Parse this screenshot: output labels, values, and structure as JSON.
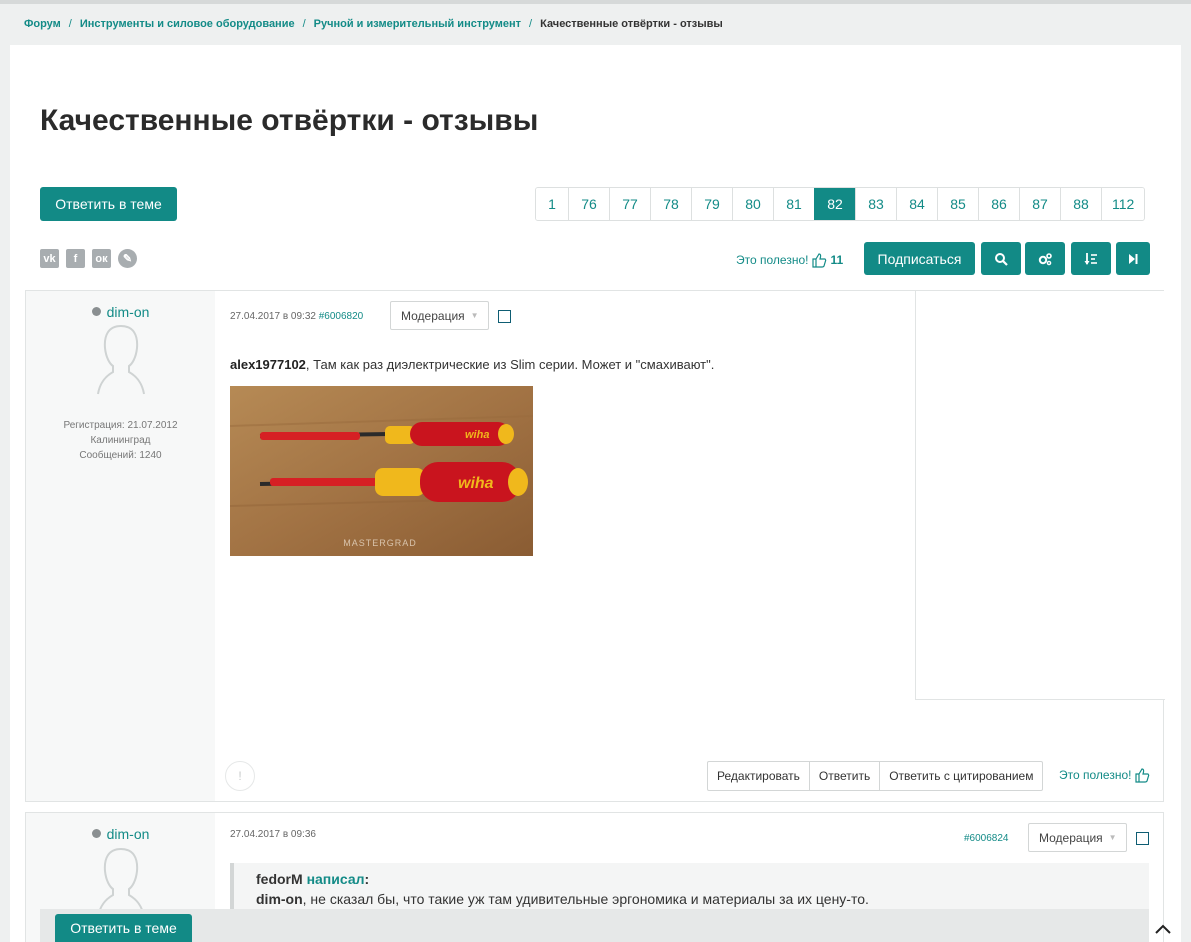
{
  "breadcrumb": {
    "items": [
      "Форум",
      "Инструменты и силовое оборудование",
      "Ручной и измерительный инструмент"
    ],
    "current": "Качественные отвёртки - отзывы"
  },
  "page_title": "Качественные отвёртки - отзывы",
  "reply_button": "Ответить в теме",
  "pagination": {
    "pages": [
      "1",
      "76",
      "77",
      "78",
      "79",
      "80",
      "81",
      "82",
      "83",
      "84",
      "85",
      "86",
      "87",
      "88",
      "112"
    ],
    "active": "82"
  },
  "social": [
    "vk",
    "f",
    "ok",
    "lj"
  ],
  "useful_top": {
    "label": "Это полезно!",
    "count": "11"
  },
  "subscribe_button": "Подписаться",
  "tools": [
    "search-icon",
    "settings-icon",
    "sort-icon",
    "last-page-icon"
  ],
  "colors": {
    "accent": "#128a86",
    "link": "#138b87",
    "background": "#eef0f0"
  },
  "posts": [
    {
      "author": "dim-on",
      "registration": "Регистрация: 21.07.2012",
      "city": "Калининград",
      "messages": "Сообщений: 1240",
      "date": "27.04.2017 в 09:32",
      "post_id": "#6006820",
      "moderation": "Модерация",
      "text_author": "alex1977102",
      "text": ", Там как раз диэлектрические из Slim серии. Может и \"смахивают\".",
      "photo_watermark": "MASTERGRAD",
      "photo_brand": "wiha",
      "actions": [
        "Редактировать",
        "Ответить",
        "Ответить с цитированием"
      ],
      "useful": "Это полезно!"
    },
    {
      "author": "dim-on",
      "date": "27.04.2017 в 09:36",
      "post_id": "#6006824",
      "moderation": "Модерация",
      "quote_author": "fedorM",
      "quote_wrote": "написал",
      "quote_colon": ":",
      "quote_user": "dim-on",
      "quote_text": ", не сказал бы, что такие уж там удивительные эргономика и материалы за их цену-то."
    }
  ]
}
